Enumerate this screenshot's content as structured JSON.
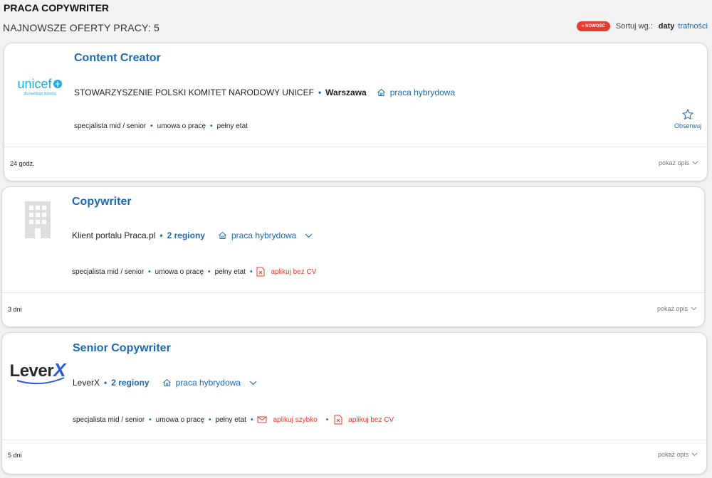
{
  "header": {
    "title": "PRACA COPYWRITER",
    "offers_count": "NAJNOWSZE OFERTY PRACY: 5",
    "badge": "NOWOŚĆ",
    "sort_label": "Sortuj wg.:",
    "sort_date": "daty",
    "sort_relevance": "trafności"
  },
  "offers": [
    {
      "title": "Content Creator",
      "company": "STOWARZYSZENIE POLSKI KOMITET NARODOWY UNICEF",
      "location": "Warszawa",
      "work_mode": "praca hybrydowa",
      "level": "specjalista mid / senior",
      "contract": "umowa o pracę",
      "time": "pełny etat",
      "age": "24 godz.",
      "show_desc": "pokaż opis",
      "observe": "Obserwuj",
      "logo_text": "unicef",
      "logo_sub": "dla każdego dziecka"
    },
    {
      "title": "Copywriter",
      "company": "Klient portalu Praca.pl",
      "location": "2 regiony",
      "work_mode": "praca hybrydowa",
      "level": "specjalista mid / senior",
      "contract": "umowa o pracę",
      "time": "pełny etat",
      "apply_no_cv": "aplikuj bez CV",
      "age": "3 dni",
      "show_desc": "pokaż opis"
    },
    {
      "title": "Senior Copywriter",
      "company": "LeverX",
      "location": "2 regiony",
      "work_mode": "praca hybrydowa",
      "level": "specjalista mid / senior",
      "contract": "umowa o pracę",
      "time": "pełny etat",
      "apply_quick": "aplikuj szybko",
      "apply_no_cv": "aplikuj bez CV",
      "age": "5 dni",
      "show_desc": "pokaż opis",
      "logo_text": "Lever",
      "logo_x": "X"
    }
  ],
  "colors": {
    "accent": "#1a6ab7",
    "red": "#e53d2f"
  }
}
